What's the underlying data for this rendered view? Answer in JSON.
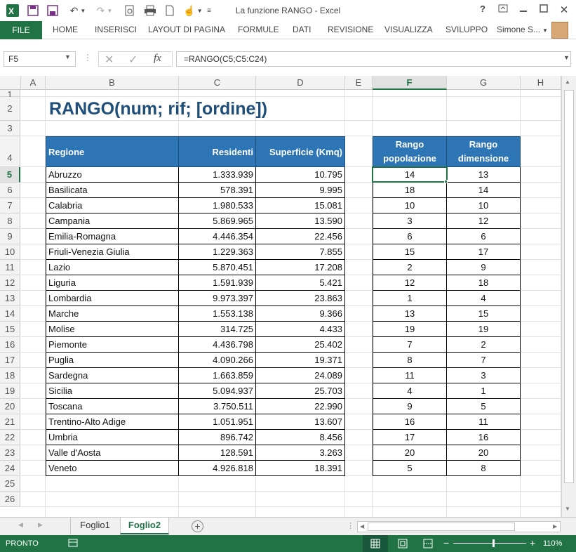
{
  "window": {
    "title": "La funzione RANGO - Excel"
  },
  "ribbon": {
    "file": "FILE",
    "tabs": [
      "HOME",
      "INSERISCI",
      "LAYOUT DI PAGINA",
      "FORMULE",
      "DATI",
      "REVISIONE",
      "VISUALIZZA",
      "SVILUPPO"
    ],
    "user": "Simone S..."
  },
  "formula_bar": {
    "name_box": "F5",
    "formula": "=RANGO(C5;C5:C24)",
    "fx": "fx"
  },
  "columns": [
    "A",
    "B",
    "C",
    "D",
    "E",
    "F",
    "G",
    "H"
  ],
  "rows": [
    "1",
    "2",
    "3",
    "4",
    "5",
    "6",
    "7",
    "8",
    "9",
    "10",
    "11",
    "12",
    "13",
    "14",
    "15",
    "16",
    "17",
    "18",
    "19",
    "20",
    "21",
    "22",
    "23",
    "24",
    "25",
    "26"
  ],
  "sheet": {
    "title": "RANGO(num; rif; [ordine])",
    "headers": {
      "region": "Regione",
      "residents": "Residenti",
      "area": "Superficie (Kmq)",
      "rank_pop": "Rango popolazione",
      "rank_dim": "Rango dimensione"
    },
    "data": [
      {
        "region": "Abruzzo",
        "residents": "1.333.939",
        "area": "10.795",
        "rank_pop": "14",
        "rank_dim": "13"
      },
      {
        "region": "Basilicata",
        "residents": "578.391",
        "area": "9.995",
        "rank_pop": "18",
        "rank_dim": "14"
      },
      {
        "region": "Calabria",
        "residents": "1.980.533",
        "area": "15.081",
        "rank_pop": "10",
        "rank_dim": "10"
      },
      {
        "region": "Campania",
        "residents": "5.869.965",
        "area": "13.590",
        "rank_pop": "3",
        "rank_dim": "12"
      },
      {
        "region": "Emilia-Romagna",
        "residents": "4.446.354",
        "area": "22.456",
        "rank_pop": "6",
        "rank_dim": "6"
      },
      {
        "region": "Friuli-Venezia Giulia",
        "residents": "1.229.363",
        "area": "7.855",
        "rank_pop": "15",
        "rank_dim": "17"
      },
      {
        "region": "Lazio",
        "residents": "5.870.451",
        "area": "17.208",
        "rank_pop": "2",
        "rank_dim": "9"
      },
      {
        "region": "Liguria",
        "residents": "1.591.939",
        "area": "5.421",
        "rank_pop": "12",
        "rank_dim": "18"
      },
      {
        "region": "Lombardia",
        "residents": "9.973.397",
        "area": "23.863",
        "rank_pop": "1",
        "rank_dim": "4"
      },
      {
        "region": "Marche",
        "residents": "1.553.138",
        "area": "9.366",
        "rank_pop": "13",
        "rank_dim": "15"
      },
      {
        "region": "Molise",
        "residents": "314.725",
        "area": "4.433",
        "rank_pop": "19",
        "rank_dim": "19"
      },
      {
        "region": "Piemonte",
        "residents": "4.436.798",
        "area": "25.402",
        "rank_pop": "7",
        "rank_dim": "2"
      },
      {
        "region": "Puglia",
        "residents": "4.090.266",
        "area": "19.371",
        "rank_pop": "8",
        "rank_dim": "7"
      },
      {
        "region": "Sardegna",
        "residents": "1.663.859",
        "area": "24.089",
        "rank_pop": "11",
        "rank_dim": "3"
      },
      {
        "region": "Sicilia",
        "residents": "5.094.937",
        "area": "25.703",
        "rank_pop": "4",
        "rank_dim": "1"
      },
      {
        "region": "Toscana",
        "residents": "3.750.511",
        "area": "22.990",
        "rank_pop": "9",
        "rank_dim": "5"
      },
      {
        "region": "Trentino-Alto Adige",
        "residents": "1.051.951",
        "area": "13.607",
        "rank_pop": "16",
        "rank_dim": "11"
      },
      {
        "region": "Umbria",
        "residents": "896.742",
        "area": "8.456",
        "rank_pop": "17",
        "rank_dim": "16"
      },
      {
        "region": "Valle d'Aosta",
        "residents": "128.591",
        "area": "3.263",
        "rank_pop": "20",
        "rank_dim": "20"
      },
      {
        "region": "Veneto",
        "residents": "4.926.818",
        "area": "18.391",
        "rank_pop": "5",
        "rank_dim": "8"
      }
    ]
  },
  "sheet_tabs": [
    {
      "label": "Foglio1",
      "active": false
    },
    {
      "label": "Foglio2",
      "active": true
    }
  ],
  "status_bar": {
    "state": "PRONTO",
    "zoom": "110%",
    "zoom_fraction": 0.55
  },
  "window_buttons": {
    "help": "?"
  },
  "colors": {
    "excel_green": "#217346",
    "header_blue": "#2e75b6",
    "title_blue": "#1f4e79"
  },
  "icons": [
    "excel-logo-icon",
    "save-icon",
    "undo-icon",
    "redo-icon",
    "print-preview-icon",
    "print-icon",
    "new-icon",
    "touch-icon",
    "help-icon",
    "restore-ribbon-icon",
    "minimize-icon",
    "maximize-icon",
    "close-icon"
  ]
}
